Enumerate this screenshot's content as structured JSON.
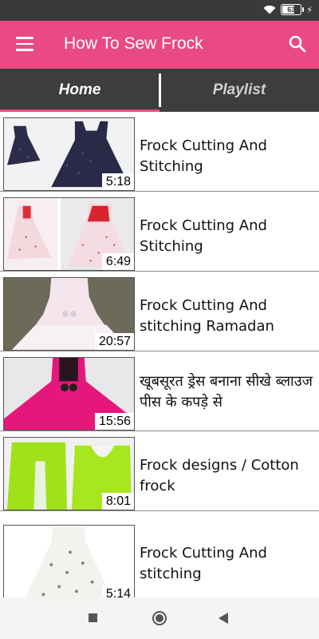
{
  "status_bar": {
    "battery_level": "63",
    "battery_fraction": 0.63,
    "icons": [
      "wifi-icon",
      "battery-icon",
      "charging-bolt-icon"
    ]
  },
  "app_bar": {
    "title": "How To Sew Frock",
    "icons": [
      "menu-icon",
      "search-icon"
    ],
    "color": "#ea4a83"
  },
  "tabs": [
    {
      "label": "Home",
      "selected": true
    },
    {
      "label": "Playlist",
      "selected": false
    }
  ],
  "videos": [
    {
      "title": "Frock Cutting And Stitching",
      "duration": "5:18"
    },
    {
      "title": "Frock Cutting And Stitching",
      "duration": "6:49"
    },
    {
      "title": "Frock Cutting And stitching Ramadan",
      "duration": "20:57"
    },
    {
      "title": "खूबसूरत ड्रेस बनाना सीखे ब्लाउज पीस के कपड़े से",
      "duration": "15:56"
    },
    {
      "title": "Frock designs / Cotton frock",
      "duration": "8:01"
    },
    {
      "title": "Frock Cutting And stitching",
      "duration": "5:14"
    }
  ],
  "nav_bar": {
    "icons": [
      "recents-icon",
      "home-icon",
      "back-icon"
    ]
  }
}
